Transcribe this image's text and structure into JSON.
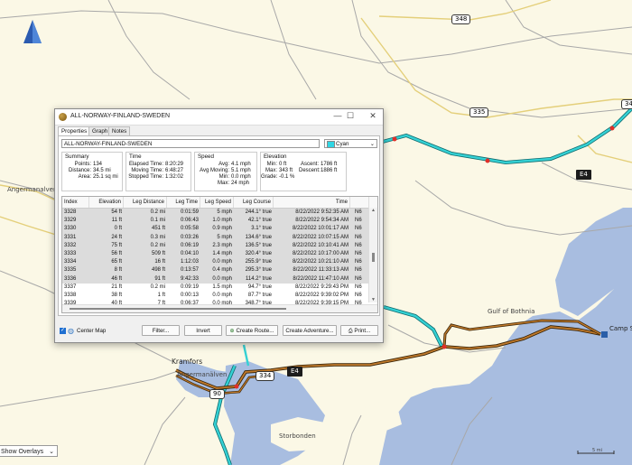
{
  "map": {
    "labels": {
      "angermanalven_left": "Angermanalven",
      "gulf_of_bothnia": "Gulf of Bothnia",
      "kramfors": "Kramfors",
      "angermanalven_bottom": "Ångermanälven",
      "storbonden": "Storbonden",
      "camp": "Camp Sw"
    },
    "road_shields": {
      "r348": "348",
      "r335": "335",
      "r34": "34",
      "e4": "E4",
      "r334": "334",
      "r90": "90"
    },
    "scale_label": "5 mi",
    "show_overlays": "Show Overlays",
    "colors": {
      "land": "#fbf8e6",
      "water": "#a8bde0",
      "track_teal": "#1ba6a8",
      "track_brown": "#8a5a20"
    }
  },
  "window": {
    "title": "ALL-NORWAY-FINLAND-SWEDEN",
    "controls": {
      "minimize": "—",
      "maximize": "☐",
      "close": "✕"
    },
    "tabs": [
      "Properties",
      "Graph",
      "Notes"
    ],
    "name_value": "ALL-NORWAY-FINLAND-SWEDEN",
    "color_value": "Cyan",
    "summary": {
      "title": "Summary",
      "rows": [
        {
          "k": "Points:",
          "v": "134"
        },
        {
          "k": "Distance:",
          "v": "34.5 mi"
        },
        {
          "k": "Area:",
          "v": "25.1 sq mi"
        }
      ]
    },
    "time": {
      "title": "Time",
      "rows": [
        {
          "k": "Elapsed Time:",
          "v": "8:20:29"
        },
        {
          "k": "Moving Time:",
          "v": "6:48:27"
        },
        {
          "k": "Stopped Time:",
          "v": "1:32:02"
        }
      ]
    },
    "speed": {
      "title": "Speed",
      "rows": [
        {
          "k": "Avg:",
          "v": "4.1 mph"
        },
        {
          "k": "Avg Moving:",
          "v": "5.1 mph"
        },
        {
          "k": "Min:",
          "v": "0.0 mph"
        },
        {
          "k": "Max:",
          "v": "24 mph"
        }
      ]
    },
    "elevation": {
      "title": "Elevation",
      "rows": [
        {
          "k": "Min:",
          "v": "0 ft",
          "k2": "Ascent:",
          "v2": "1786 ft"
        },
        {
          "k": "Max:",
          "v": "343 ft",
          "k2": "Descent:",
          "v2": "1886 ft"
        },
        {
          "k": "Grade:",
          "v": "-0.1 %",
          "k2": "",
          "v2": ""
        }
      ]
    },
    "table": {
      "headers": [
        "Index",
        "Elevation",
        "Leg Distance",
        "Leg Time",
        "Leg Speed",
        "Leg Course",
        "Time",
        ""
      ],
      "rows": [
        [
          "3328",
          "54 ft",
          "0.2 mi",
          "0:01:59",
          "5 mph",
          "244.1° true",
          "8/22/2022 9:52:35 AM",
          "N6"
        ],
        [
          "3329",
          "11 ft",
          "0.1 mi",
          "0:06:43",
          "1.0 mph",
          "42.1° true",
          "8/22/2022 9:54:34 AM",
          "N6"
        ],
        [
          "3330",
          "0 ft",
          "451 ft",
          "0:05:58",
          "0.9 mph",
          "3.1° true",
          "8/22/2022 10:01:17 AM",
          "N6"
        ],
        [
          "3331",
          "24 ft",
          "0.3 mi",
          "0:03:26",
          "5 mph",
          "134.6° true",
          "8/22/2022 10:07:15 AM",
          "N6"
        ],
        [
          "3332",
          "75 ft",
          "0.2 mi",
          "0:06:19",
          "2.3 mph",
          "136.5° true",
          "8/22/2022 10:10:41 AM",
          "N6"
        ],
        [
          "3333",
          "56 ft",
          "509 ft",
          "0:04:10",
          "1.4 mph",
          "320.4° true",
          "8/22/2022 10:17:00 AM",
          "N6"
        ],
        [
          "3334",
          "65 ft",
          "16 ft",
          "1:12:03",
          "0.0 mph",
          "255.9° true",
          "8/22/2022 10:21:10 AM",
          "N6"
        ],
        [
          "3335",
          "8 ft",
          "498 ft",
          "0:13:57",
          "0.4 mph",
          "295.3° true",
          "8/22/2022 11:33:13 AM",
          "N6"
        ],
        [
          "3336",
          "46 ft",
          "91 ft",
          "9:42:33",
          "0.0 mph",
          "114.2° true",
          "8/22/2022 11:47:10 AM",
          "N6"
        ],
        [
          "3337",
          "21 ft",
          "0.2 mi",
          "0:09:19",
          "1.5 mph",
          "94.7° true",
          "8/22/2022 9:29:43 PM",
          "N6"
        ],
        [
          "3338",
          "38 ft",
          "1 ft",
          "0:00:13",
          "0.0 mph",
          "87.7° true",
          "8/22/2022 9:39:02 PM",
          "N6"
        ],
        [
          "3339",
          "40 ft",
          "7 ft",
          "0:06:37",
          "0.0 mph",
          "348.7° true",
          "8/22/2022 9:39:15 PM",
          "N6"
        ]
      ]
    },
    "buttons": {
      "center_map": "Center Map",
      "filter": "Filter...",
      "invert": "Invert",
      "create_route": "Create Route...",
      "create_adventure": "Create Adventure...",
      "print": "Print..."
    }
  }
}
